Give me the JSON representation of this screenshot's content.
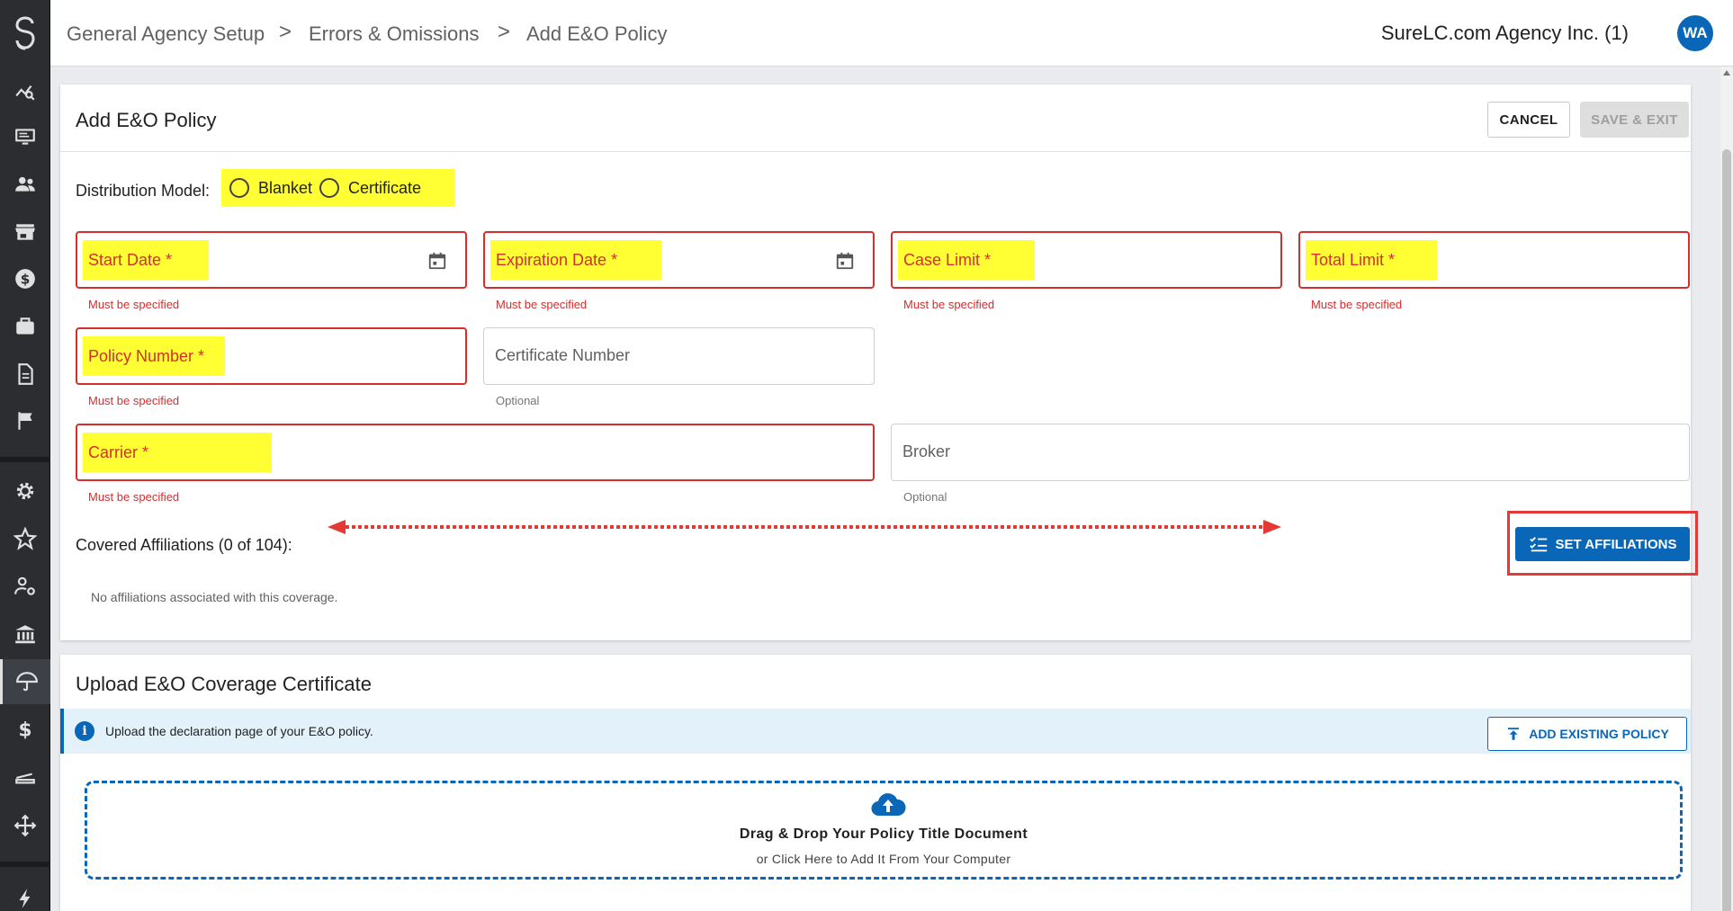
{
  "breadcrumb": {
    "items": [
      "General Agency Setup",
      "Errors & Omissions",
      "Add E&O Policy"
    ],
    "separator": ">"
  },
  "header": {
    "agency_name": "SureLC.com Agency Inc. (1)",
    "avatar_initials": "WA"
  },
  "sidebar": {
    "items": [
      "logo-icon",
      "analytics-icon",
      "monitor-icon",
      "people-icon",
      "store-icon",
      "dollar-circle-icon",
      "briefcase-icon",
      "document-icon",
      "flag-icon",
      "gear-icon",
      "star-icon",
      "user-settings-icon",
      "bank-icon",
      "umbrella-icon",
      "dollar-icon",
      "stack-icon",
      "move-icon",
      "bolt-icon"
    ],
    "active": "umbrella-icon"
  },
  "form": {
    "title": "Add E&O Policy",
    "cancel_label": "CANCEL",
    "save_exit_label": "SAVE & EXIT",
    "distribution_label": "Distribution Model:",
    "distribution_options": [
      "Blanket",
      "Certificate"
    ],
    "fields": {
      "start_date": {
        "label": "Start Date *",
        "helper": "Must be specified"
      },
      "expiration_date": {
        "label": "Expiration Date *",
        "helper": "Must be specified"
      },
      "case_limit": {
        "label": "Case Limit *",
        "helper": "Must be specified"
      },
      "total_limit": {
        "label": "Total Limit *",
        "helper": "Must be specified"
      },
      "policy_number": {
        "label": "Policy Number *",
        "helper": "Must be specified"
      },
      "certificate_number": {
        "label": "Certificate Number",
        "helper": "Optional"
      },
      "carrier": {
        "label": "Carrier *",
        "helper": "Must be specified"
      },
      "broker": {
        "label": "Broker",
        "helper": "Optional"
      }
    },
    "covered_affiliations_label": "Covered Affiliations (0 of 104):",
    "set_affiliations_label": "SET AFFILIATIONS",
    "no_affiliations_text": "No affiliations associated with this coverage."
  },
  "upload": {
    "title": "Upload E&O Coverage Certificate",
    "info_text": "Upload the declaration page of your E&O policy.",
    "add_existing_label": "ADD EXISTING POLICY",
    "drop_title": "Drag & Drop Your Policy Title Document",
    "drop_subtitle": "or Click Here to Add It From Your Computer"
  },
  "colors": {
    "accent": "#0a66b7",
    "error": "#d32f2f",
    "highlight": "#ffff33",
    "annotation_red": "#e53935"
  }
}
